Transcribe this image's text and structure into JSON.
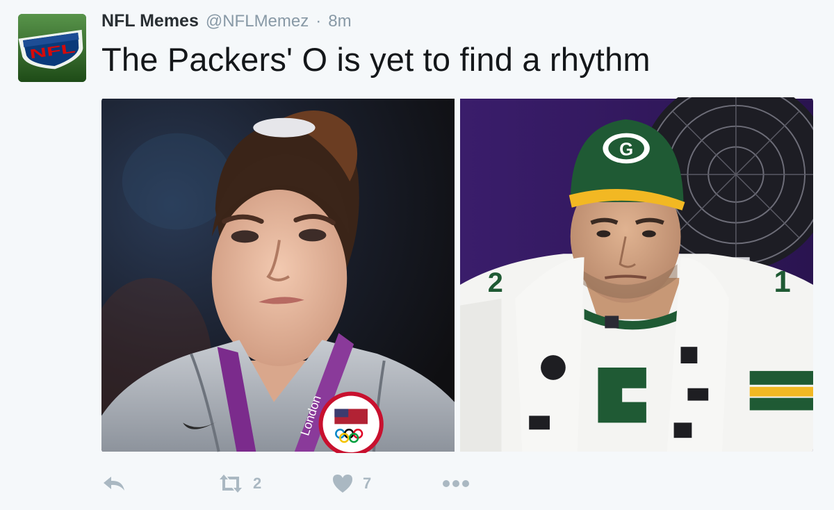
{
  "tweet": {
    "display_name": "NFL Memes",
    "handle": "@NFLMemez",
    "separator": "·",
    "timestamp": "8m",
    "text": "The Packers' O is yet to find a rhythm",
    "avatar_logo_text": "NFL",
    "media": [
      {
        "subject": "gymnast-unimpressed-face",
        "medal_ribbon_text": "London",
        "badge_text": "UNITED STATES OLYMPIC TEAM"
      },
      {
        "subject": "packers-quarterback-bench",
        "cap_logo": "G"
      }
    ],
    "actions": {
      "reply_icon": "reply-icon",
      "retweet_icon": "retweet-icon",
      "retweet_count": "2",
      "like_icon": "heart-icon",
      "like_count": "7",
      "more_icon": "more-icon"
    }
  },
  "colors": {
    "background": "#f5f8fa",
    "name": "#292f33",
    "muted": "#8899a6",
    "action": "#aab8c2",
    "packers_green": "#1f5a34",
    "packers_gold": "#f2b823"
  }
}
